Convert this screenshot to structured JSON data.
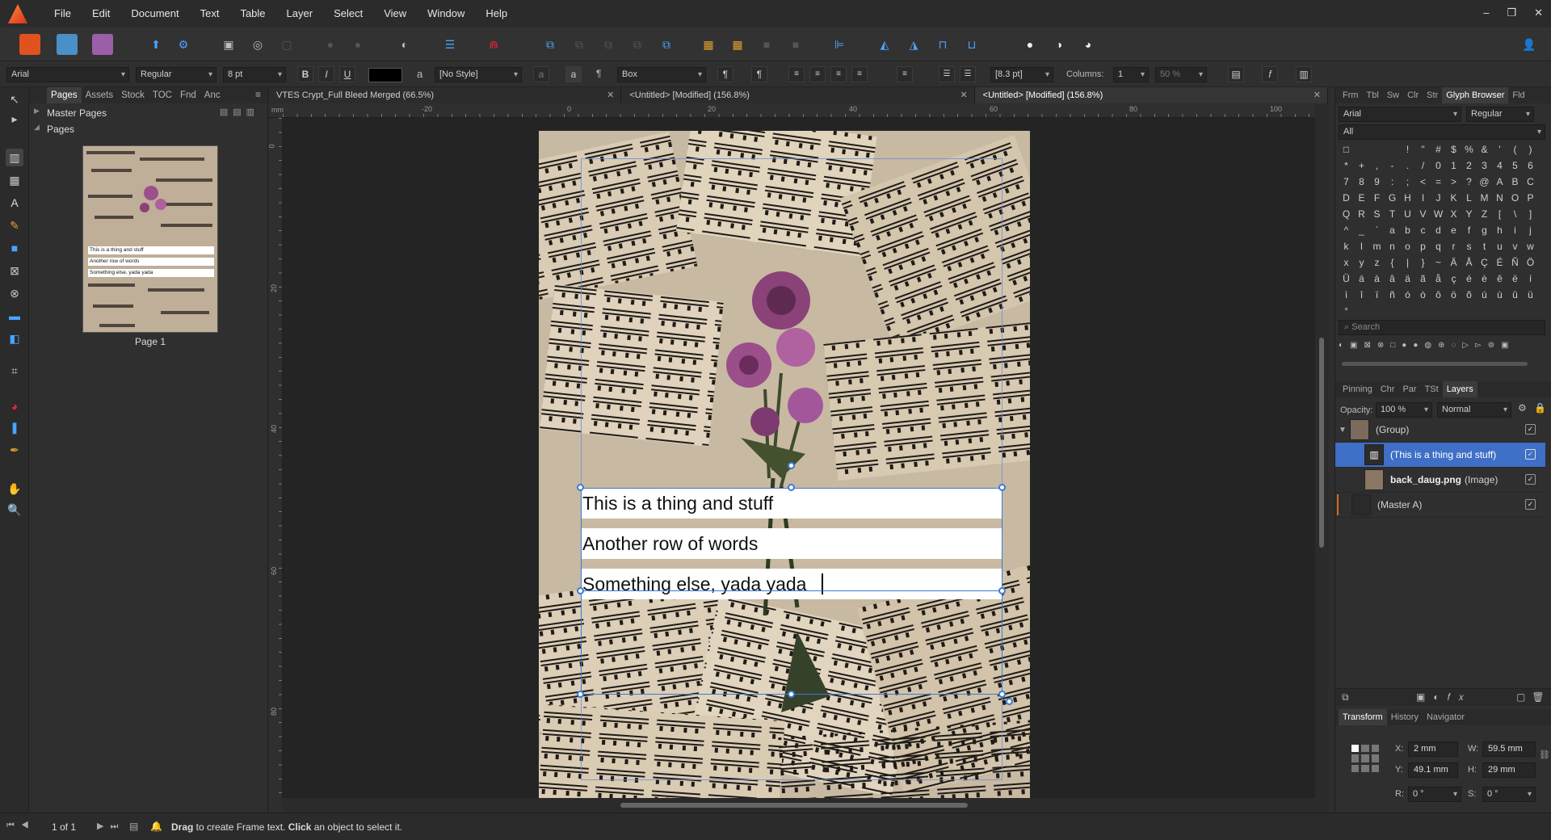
{
  "menu": [
    "File",
    "Edit",
    "Document",
    "Text",
    "Table",
    "Layer",
    "Select",
    "View",
    "Window",
    "Help"
  ],
  "window_controls": {
    "minimize": "–",
    "restore": "❐",
    "close": "✕"
  },
  "context_toolbar": {
    "font": "Arial",
    "style": "Regular",
    "size": "8 pt",
    "bold": "B",
    "italic": "I",
    "underline": "U",
    "paragraph_style": "[No Style]",
    "frame_type": "Box",
    "spacing": "[8.3 pt]",
    "columns_label": "Columns:",
    "columns": "1",
    "zoom_value": "50 %"
  },
  "left_panel": {
    "tabs": [
      "Pages",
      "Assets",
      "Stock",
      "TOC",
      "Fnd",
      "Anc"
    ],
    "master_pages": "Master Pages",
    "pages": "Pages",
    "page_label": "Page 1",
    "thumb_lines": [
      "This is a thing and stuff",
      "Another row of words",
      "Something else, yada yada"
    ]
  },
  "doc_tabs": [
    {
      "title": "VTES Crypt_Full Bleed Merged (66.5%)"
    },
    {
      "title": "<Untitled> [Modified] (156.8%)"
    },
    {
      "title": "<Untitled> [Modified] (156.8%)"
    }
  ],
  "ruler_h": [
    "-20",
    "0",
    "20",
    "40",
    "60",
    "80",
    "100"
  ],
  "ruler_v": [
    "0",
    "20",
    "40",
    "60",
    "80"
  ],
  "ruler_unit": "mm",
  "canvas_text": [
    "This is a thing and stuff",
    "Another row of words",
    "Something else, yada yada"
  ],
  "right_panel": {
    "top_tabs": [
      "Frm",
      "Tbl",
      "Sw",
      "Clr",
      "Str",
      "Glyph Browser",
      "Fld"
    ],
    "glyph_font": "Arial",
    "glyph_style": "Regular",
    "glyph_filter": "All",
    "glyphs": [
      "□",
      "",
      "",
      "",
      "!",
      "\"",
      "#",
      "$",
      "%",
      "&",
      "'",
      "(",
      ")",
      "*",
      "+",
      ",",
      "-",
      ".",
      "/",
      "0",
      "1",
      "2",
      "3",
      "4",
      "5",
      "6",
      "7",
      "8",
      "9",
      ":",
      ";",
      "<",
      "=",
      ">",
      "?",
      "@",
      "A",
      "B",
      "C",
      "D",
      "E",
      "F",
      "G",
      "H",
      "I",
      "J",
      "K",
      "L",
      "M",
      "N",
      "O",
      "P",
      "Q",
      "R",
      "S",
      "T",
      "U",
      "V",
      "W",
      "X",
      "Y",
      "Z",
      "[",
      "\\",
      "]",
      "^",
      "_",
      "`",
      "a",
      "b",
      "c",
      "d",
      "e",
      "f",
      "g",
      "h",
      "i",
      "j",
      "k",
      "l",
      "m",
      "n",
      "o",
      "p",
      "q",
      "r",
      "s",
      "t",
      "u",
      "v",
      "w",
      "x",
      "y",
      "z",
      "{",
      "|",
      "}",
      "~",
      "Ä",
      "Å",
      "Ç",
      "É",
      "Ñ",
      "Ö",
      "Ü",
      "á",
      "à",
      "â",
      "ä",
      "ã",
      "å",
      "ç",
      "é",
      "è",
      "ê",
      "ë",
      "í",
      "ì",
      "î",
      "ï",
      "ñ",
      "ó",
      "ò",
      "ô",
      "ö",
      "õ",
      "ú",
      "ù",
      "û",
      "ü",
      "°"
    ],
    "search_placeholder": "Search",
    "layer_tabs": [
      "Pinning",
      "Chr",
      "Par",
      "TSt",
      "Layers"
    ],
    "opacity_label": "Opacity:",
    "opacity": "100 %",
    "blend": "Normal",
    "layers": [
      {
        "name": "(Group)",
        "type": ""
      },
      {
        "name": "(This is a thing and stuff)",
        "type": ""
      },
      {
        "name": "back_daug.png",
        "type": "(Image)"
      },
      {
        "name": "(Master A)",
        "type": ""
      }
    ],
    "bottom_tabs": [
      "Transform",
      "History",
      "Navigator"
    ],
    "transform": {
      "x_label": "X:",
      "x": "2 mm",
      "y_label": "Y:",
      "y": "49.1 mm",
      "w_label": "W:",
      "w": "59.5 mm",
      "h_label": "H:",
      "h": "29 mm",
      "r_label": "R:",
      "r": "0 °",
      "s_label": "S:",
      "s": "0 °"
    }
  },
  "status": {
    "page_of": "1 of 1",
    "hint_bold_1": "Drag",
    "hint_1": " to create Frame text. ",
    "hint_bold_2": "Click",
    "hint_2": " an object to select it."
  },
  "colors": {
    "accent": "#3a7bd5",
    "selection": "#3f6fc6",
    "text_fill": "#000000"
  }
}
